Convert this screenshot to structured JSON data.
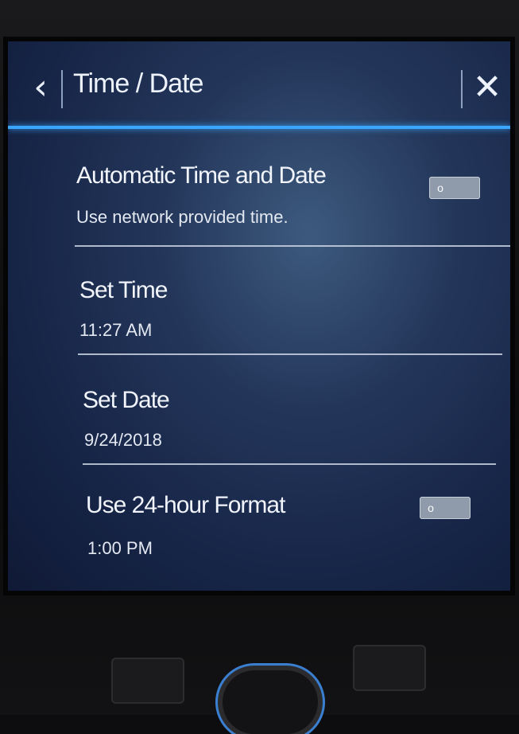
{
  "header": {
    "title": "Time / Date",
    "back_icon": "chevron-left-icon",
    "close_icon": "close-icon",
    "back_glyph": "‹",
    "close_glyph": "✕"
  },
  "colors": {
    "accent": "#3aa6ff",
    "screen_bg": "#162446",
    "text": "#f1f4fa"
  },
  "settings": [
    {
      "label": "Automatic Time and Date",
      "sub": "Use network provided time.",
      "toggle": {
        "state": "off",
        "knob_glyph": "o"
      }
    },
    {
      "label": "Set Time",
      "sub": "11:27 AM"
    },
    {
      "label": "Set Date",
      "sub": "9/24/2018"
    },
    {
      "label": "Use 24-hour Format",
      "sub": "1:00 PM",
      "toggle": {
        "state": "off",
        "knob_glyph": "o"
      }
    }
  ]
}
